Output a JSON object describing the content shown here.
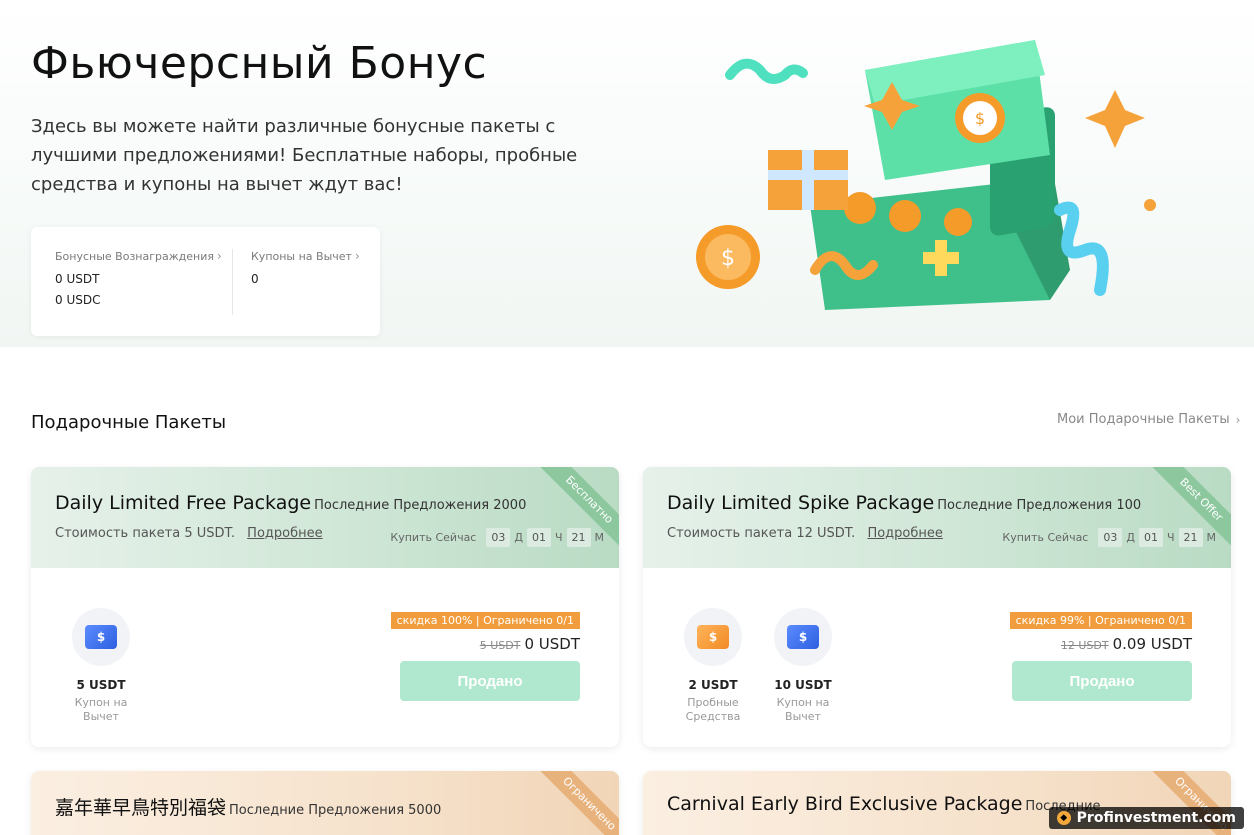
{
  "hero": {
    "title": "Фьючерсный Бонус",
    "description": "Здесь вы можете найти различные бонусные пакеты с лучшими предложениями! Бесплатные наборы, пробные средства и купоны на вычет ждут вас!",
    "rewards_label": "Бонусные Вознаграждения",
    "rewards_usdt": "0 USDT",
    "rewards_usdc": "0 USDC",
    "coupons_label": "Купоны на Вычет",
    "coupons_value": "0"
  },
  "section": {
    "title": "Подарочные Пакеты",
    "my_packages": "Мои Подарочные Пакеты"
  },
  "cards": [
    {
      "name": "Daily Limited Free Package",
      "sub": "Последние Предложения 2000",
      "cost": "Стоимость пакета 5 USDT.",
      "more": "Подробнее",
      "buy_now": "Купить Сейчас",
      "t1": "03",
      "u1": "Д",
      "t2": "01",
      "u2": "Ч",
      "t3": "21",
      "u3": "М",
      "ribbon": "Бесплатно",
      "item1_amt": "5 USDT",
      "item1_lbl": "Купон на Вычет",
      "tag": "скидка 100% | Ограничено 0/1",
      "old_price": "5 USDT",
      "new_price": "0 USDT",
      "button": "Продано"
    },
    {
      "name": "Daily Limited Spike Package",
      "sub": "Последние Предложения 100",
      "cost": "Стоимость пакета 12 USDT.",
      "more": "Подробнее",
      "buy_now": "Купить Сейчас",
      "t1": "03",
      "u1": "Д",
      "t2": "01",
      "u2": "Ч",
      "t3": "21",
      "u3": "М",
      "ribbon": "Best Offer",
      "item1_amt": "2 USDT",
      "item1_lbl": "Пробные Средства",
      "item2_amt": "10 USDT",
      "item2_lbl": "Купон на Вычет",
      "tag": "скидка 99% | Ограничено 0/1",
      "old_price": "12 USDT",
      "new_price": "0.09 USDT",
      "button": "Продано"
    },
    {
      "name": "嘉年華早鳥特別福袋",
      "sub": "Последние Предложения 5000",
      "ribbon": "Ограничено"
    },
    {
      "name": "Carnival Early Bird Exclusive Package",
      "sub": "Последние",
      "ribbon": "Ограничено"
    }
  ],
  "watermark": "Profinvestment.com",
  "colors": {
    "accent_green": "#b0e8cf",
    "tag_orange": "#f29d3d"
  }
}
